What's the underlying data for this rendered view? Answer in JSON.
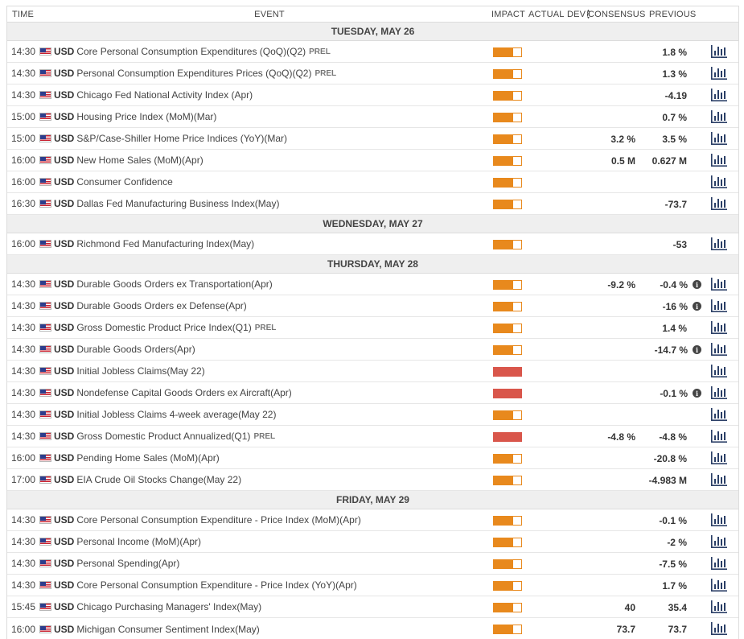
{
  "header": {
    "time": "TIME",
    "event": "EVENT",
    "impact": "IMPACT",
    "actual": "ACTUAL",
    "dev": "DEV",
    "consensus": "CONSENSUS",
    "previous": "PREVIOUS"
  },
  "colors": {
    "medium_impact": "#e8891d",
    "high_impact": "#d9564b",
    "chart_icon": "#2a3e66"
  },
  "days": [
    {
      "label": "TUESDAY, MAY 26",
      "events": [
        {
          "time": "14:30",
          "currency": "USD",
          "name": "Core Personal Consumption Expenditures (QoQ)(Q2)",
          "tag": "PREL",
          "impact": "medium",
          "consensus": "",
          "previous": "1.8 %",
          "info": false
        },
        {
          "time": "14:30",
          "currency": "USD",
          "name": "Personal Consumption Expenditures Prices (QoQ)(Q2)",
          "tag": "PREL",
          "impact": "medium",
          "consensus": "",
          "previous": "1.3 %",
          "info": false
        },
        {
          "time": "14:30",
          "currency": "USD",
          "name": "Chicago Fed National Activity Index (Apr)",
          "tag": "",
          "impact": "medium",
          "consensus": "",
          "previous": "-4.19",
          "info": false
        },
        {
          "time": "15:00",
          "currency": "USD",
          "name": "Housing Price Index (MoM)(Mar)",
          "tag": "",
          "impact": "medium",
          "consensus": "",
          "previous": "0.7 %",
          "info": false
        },
        {
          "time": "15:00",
          "currency": "USD",
          "name": "S&P/Case-Shiller Home Price Indices (YoY)(Mar)",
          "tag": "",
          "impact": "medium",
          "consensus": "3.2 %",
          "previous": "3.5 %",
          "info": false
        },
        {
          "time": "16:00",
          "currency": "USD",
          "name": "New Home Sales (MoM)(Apr)",
          "tag": "",
          "impact": "medium",
          "consensus": "0.5 M",
          "previous": "0.627 M",
          "info": false
        },
        {
          "time": "16:00",
          "currency": "USD",
          "name": "Consumer Confidence",
          "tag": "",
          "impact": "medium",
          "consensus": "",
          "previous": "",
          "info": false
        },
        {
          "time": "16:30",
          "currency": "USD",
          "name": "Dallas Fed Manufacturing Business Index(May)",
          "tag": "",
          "impact": "medium",
          "consensus": "",
          "previous": "-73.7",
          "info": false
        }
      ]
    },
    {
      "label": "WEDNESDAY, MAY 27",
      "events": [
        {
          "time": "16:00",
          "currency": "USD",
          "name": "Richmond Fed Manufacturing Index(May)",
          "tag": "",
          "impact": "medium",
          "consensus": "",
          "previous": "-53",
          "info": false
        }
      ]
    },
    {
      "label": "THURSDAY, MAY 28",
      "events": [
        {
          "time": "14:30",
          "currency": "USD",
          "name": "Durable Goods Orders ex Transportation(Apr)",
          "tag": "",
          "impact": "medium",
          "consensus": "-9.2 %",
          "previous": "-0.4 %",
          "info": true
        },
        {
          "time": "14:30",
          "currency": "USD",
          "name": "Durable Goods Orders ex Defense(Apr)",
          "tag": "",
          "impact": "medium",
          "consensus": "",
          "previous": "-16 %",
          "info": true
        },
        {
          "time": "14:30",
          "currency": "USD",
          "name": "Gross Domestic Product Price Index(Q1)",
          "tag": "PREL",
          "impact": "medium",
          "consensus": "",
          "previous": "1.4 %",
          "info": false
        },
        {
          "time": "14:30",
          "currency": "USD",
          "name": "Durable Goods Orders(Apr)",
          "tag": "",
          "impact": "medium",
          "consensus": "",
          "previous": "-14.7 %",
          "info": true
        },
        {
          "time": "14:30",
          "currency": "USD",
          "name": "Initial Jobless Claims(May 22)",
          "tag": "",
          "impact": "high",
          "consensus": "",
          "previous": "",
          "info": false
        },
        {
          "time": "14:30",
          "currency": "USD",
          "name": "Nondefense Capital Goods Orders ex Aircraft(Apr)",
          "tag": "",
          "impact": "high",
          "consensus": "",
          "previous": "-0.1 %",
          "info": true
        },
        {
          "time": "14:30",
          "currency": "USD",
          "name": "Initial Jobless Claims 4-week average(May 22)",
          "tag": "",
          "impact": "medium",
          "consensus": "",
          "previous": "",
          "info": false
        },
        {
          "time": "14:30",
          "currency": "USD",
          "name": "Gross Domestic Product Annualized(Q1)",
          "tag": "PREL",
          "impact": "high",
          "consensus": "-4.8 %",
          "previous": "-4.8 %",
          "info": false
        },
        {
          "time": "16:00",
          "currency": "USD",
          "name": "Pending Home Sales (MoM)(Apr)",
          "tag": "",
          "impact": "medium",
          "consensus": "",
          "previous": "-20.8 %",
          "info": false
        },
        {
          "time": "17:00",
          "currency": "USD",
          "name": "EIA Crude Oil Stocks Change(May 22)",
          "tag": "",
          "impact": "medium",
          "consensus": "",
          "previous": "-4.983 M",
          "info": false
        }
      ]
    },
    {
      "label": "FRIDAY, MAY 29",
      "events": [
        {
          "time": "14:30",
          "currency": "USD",
          "name": "Core Personal Consumption Expenditure - Price Index (MoM)(Apr)",
          "tag": "",
          "impact": "medium",
          "consensus": "",
          "previous": "-0.1 %",
          "info": false
        },
        {
          "time": "14:30",
          "currency": "USD",
          "name": "Personal Income (MoM)(Apr)",
          "tag": "",
          "impact": "medium",
          "consensus": "",
          "previous": "-2 %",
          "info": false
        },
        {
          "time": "14:30",
          "currency": "USD",
          "name": "Personal Spending(Apr)",
          "tag": "",
          "impact": "medium",
          "consensus": "",
          "previous": "-7.5 %",
          "info": false
        },
        {
          "time": "14:30",
          "currency": "USD",
          "name": "Core Personal Consumption Expenditure - Price Index (YoY)(Apr)",
          "tag": "",
          "impact": "medium",
          "consensus": "",
          "previous": "1.7 %",
          "info": false
        },
        {
          "time": "15:45",
          "currency": "USD",
          "name": "Chicago Purchasing Managers' Index(May)",
          "tag": "",
          "impact": "medium",
          "consensus": "40",
          "previous": "35.4",
          "info": false
        },
        {
          "time": "16:00",
          "currency": "USD",
          "name": "Michigan Consumer Sentiment Index(May)",
          "tag": "",
          "impact": "medium",
          "consensus": "73.7",
          "previous": "73.7",
          "info": false
        }
      ]
    }
  ]
}
